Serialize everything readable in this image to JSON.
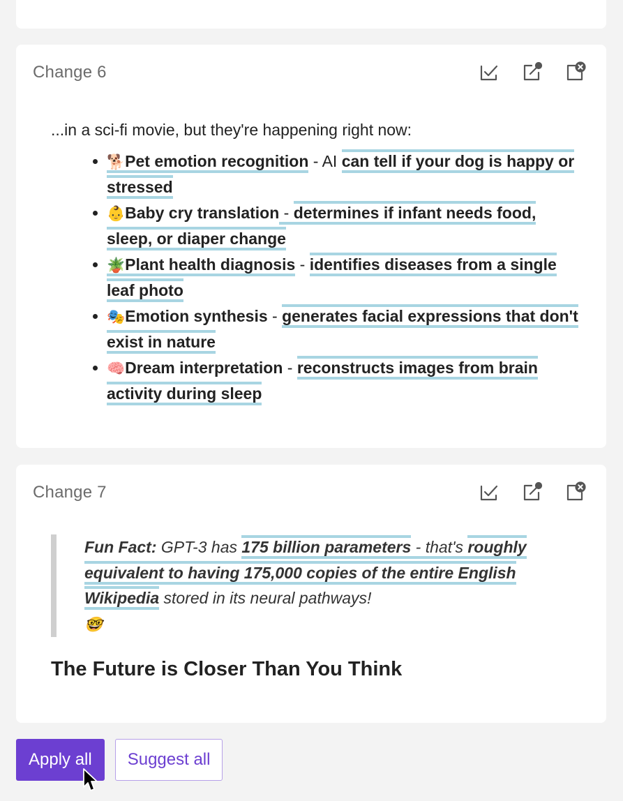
{
  "changes": [
    {
      "title": "Change 6",
      "intro": "...in a sci-fi movie, but they're happening right now:",
      "items": [
        {
          "emoji": "🐕",
          "label": "Pet emotion recognition",
          "sep": " - ",
          "pre": "AI ",
          "desc": "can tell if your dog is happy or stressed"
        },
        {
          "emoji": "👶",
          "label": "Baby cry translation",
          "sep": " - ",
          "pre": "",
          "desc": "determines if infant needs food, sleep, or diaper change"
        },
        {
          "emoji": "🪴",
          "label": "Plant health diagnosis",
          "sep": " - ",
          "pre": "",
          "desc": "identifies diseases from a single leaf photo"
        },
        {
          "emoji": "🎭",
          "label": "Emotion synthesis",
          "sep": " - ",
          "pre": "",
          "desc": "generates facial expressions that don't exist in nature"
        },
        {
          "emoji": "🧠",
          "label": "Dream interpretation",
          "sep": " - ",
          "pre": "",
          "desc": "reconstructs images from brain activity during sleep"
        }
      ]
    },
    {
      "title": "Change 7",
      "quote": {
        "lead": "Fun Fact:",
        "t1": " GPT-3 has ",
        "b1": "175 billion parameters",
        "t2": " - that's ",
        "b2": "roughly equivalent to having 175,000 copies of the entire English Wikipedia",
        "t3": " stored in its neural pathways!",
        "emoji": "🤓"
      },
      "heading": "The Future is Closer Than You Think"
    }
  ],
  "icons": [
    "accept-icon",
    "suggest-icon",
    "reject-icon"
  ],
  "buttons": {
    "apply_all": "Apply all",
    "suggest_all": "Suggest all"
  },
  "colors": {
    "accent": "#6c3fd1",
    "highlight": "#a8d5e2"
  }
}
